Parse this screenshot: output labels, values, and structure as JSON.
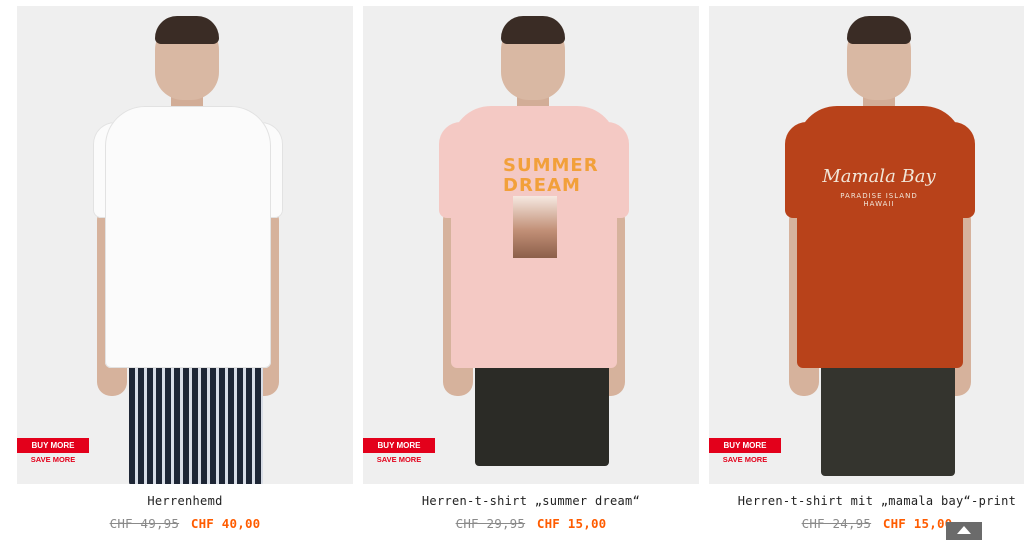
{
  "products": [
    {
      "name": "Herrenhemd",
      "old_price": "CHF 49,95",
      "new_price": "CHF 40,00",
      "badge_top": "BUY MORE",
      "badge_bottom": "SAVE MORE"
    },
    {
      "name": "Herren-t-shirt „summer dream“",
      "old_price": "CHF 29,95",
      "new_price": "CHF 15,00",
      "badge_top": "BUY MORE",
      "badge_bottom": "SAVE MORE",
      "print_text": "SUMMER DREAM"
    },
    {
      "name": "Herren-t-shirt mit „mamala bay“-print",
      "old_price": "CHF 24,95",
      "new_price": "CHF 15,00",
      "badge_top": "BUY MORE",
      "badge_bottom": "SAVE MORE",
      "print_text": "Mamala Bay",
      "print_subtext": "PARADISE ISLAND HAWAII"
    }
  ],
  "colors": {
    "badge_red": "#e3001b",
    "sale_orange": "#ff5c00",
    "old_price_gray": "#8a8a8a",
    "photo_bg": "#efefef"
  },
  "scroll_top": {
    "icon": "chevron-up-icon"
  }
}
